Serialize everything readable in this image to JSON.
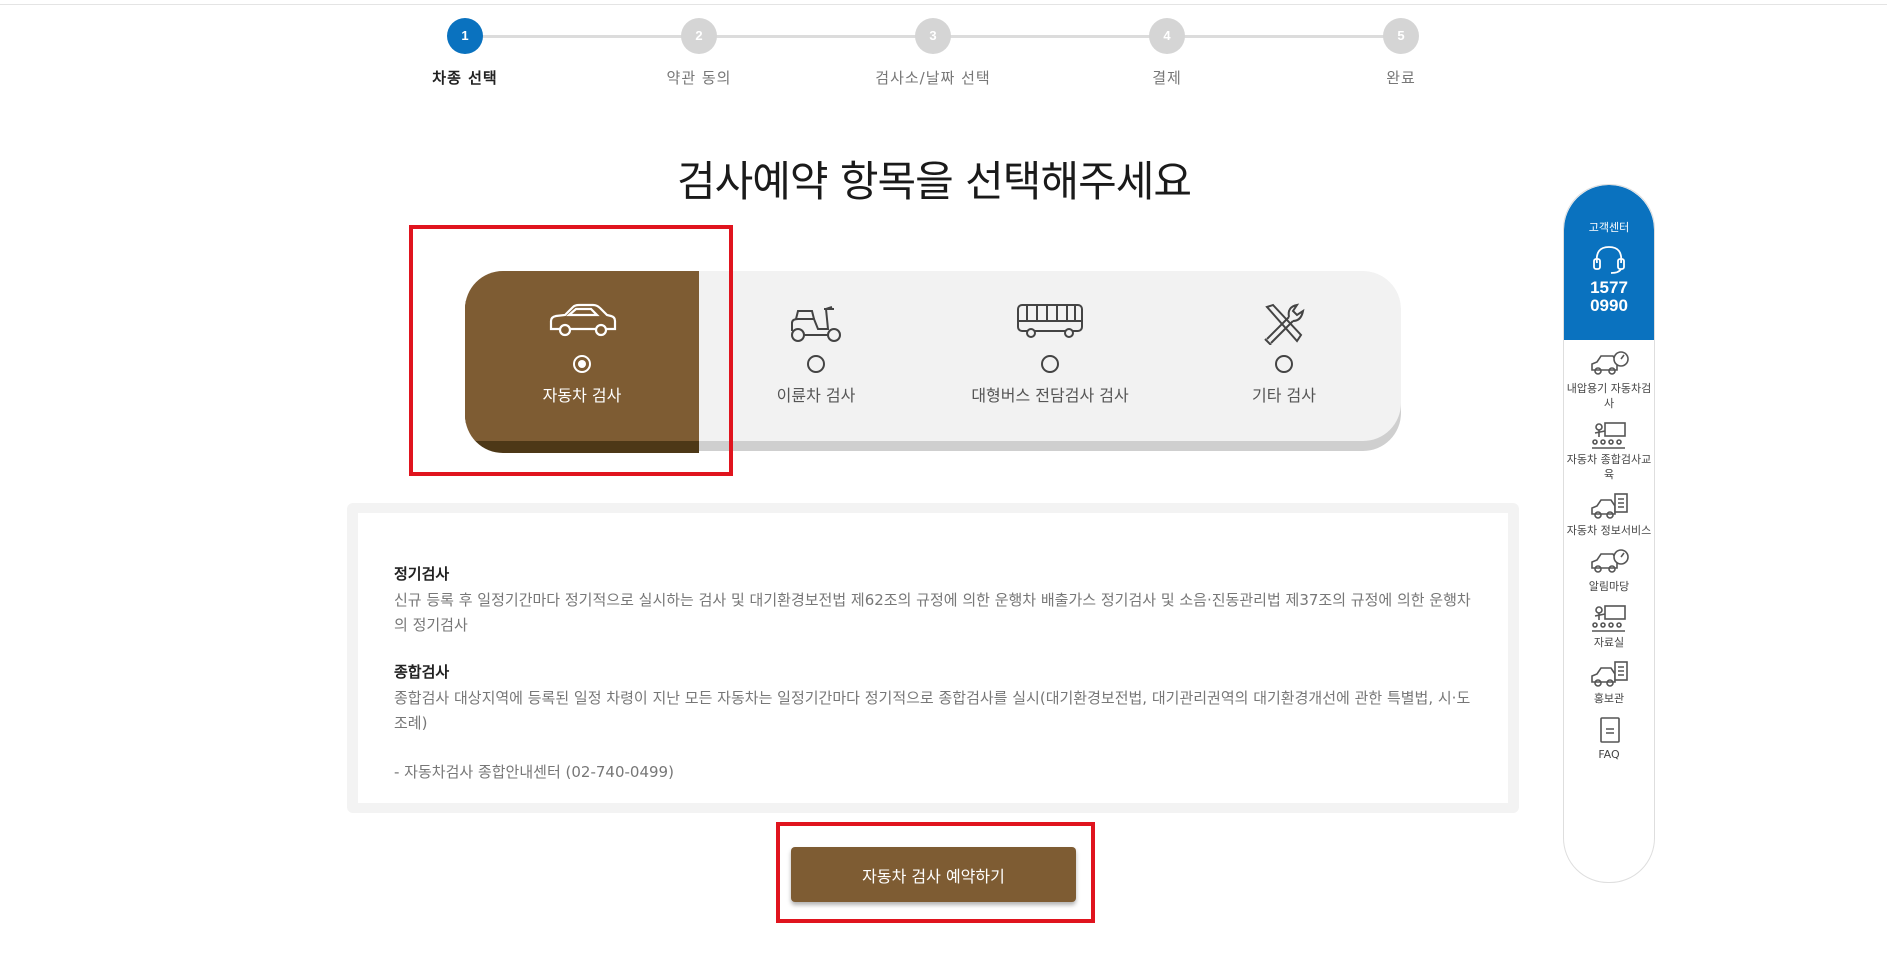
{
  "steps": [
    {
      "num": "1",
      "label": "차종 선택",
      "active": true
    },
    {
      "num": "2",
      "label": "약관 동의",
      "active": false
    },
    {
      "num": "3",
      "label": "검사소/날짜 선택",
      "active": false
    },
    {
      "num": "4",
      "label": "결제",
      "active": false
    },
    {
      "num": "5",
      "label": "완료",
      "active": false
    }
  ],
  "heading": "검사예약 항목을 선택해주세요",
  "options": [
    {
      "label": "자동차 검사",
      "icon": "car-icon",
      "selected": true
    },
    {
      "label": "이륜차 검사",
      "icon": "scooter-icon",
      "selected": false
    },
    {
      "label": "대형버스 전담검사 검사",
      "icon": "bus-icon",
      "selected": false
    },
    {
      "label": "기타 검사",
      "icon": "tools-icon",
      "selected": false
    }
  ],
  "description": {
    "sections": [
      {
        "title": "정기검사",
        "text": "신규 등록 후 일정기간마다 정기적으로 실시하는 검사 및 대기환경보전법 제62조의 규정에 의한 운행차 배출가스 정기검사 및 소음·진동관리법 제37조의 규정에 의한 운행차의 정기검사"
      },
      {
        "title": "종합검사",
        "text": "종합검사 대상지역에 등록된 일정 차령이 지난 모든 자동차는 일정기간마다 정기적으로 종합검사를 실시(대기환경보전법, 대기관리권역의 대기환경개선에 관한 특별법, 시·도 조례)"
      }
    ],
    "contact": "- 자동차검사 종합안내센터 (02-740-0499)"
  },
  "cta_label": "자동차 검사 예약하기",
  "quick_menu": {
    "title": "고객센터",
    "phone_line1": "1577",
    "phone_line2": "0990",
    "items": [
      {
        "label": "내압용기 자동차검사",
        "icon": "car-gauge-icon"
      },
      {
        "label": "자동차 종합검사교육",
        "icon": "classroom-icon"
      },
      {
        "label": "자동차 정보서비스",
        "icon": "car-checklist-icon"
      },
      {
        "label": "알림마당",
        "icon": "car-gauge-icon"
      },
      {
        "label": "자료실",
        "icon": "classroom-icon"
      },
      {
        "label": "홍보관",
        "icon": "car-checklist-icon"
      },
      {
        "label": "FAQ",
        "icon": "notebook-icon"
      }
    ]
  },
  "colors": {
    "accent_blue": "#0a72bf",
    "brown": "#7e5c33",
    "highlight_red": "#e0141e"
  }
}
